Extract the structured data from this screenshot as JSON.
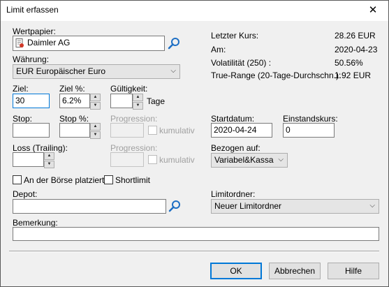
{
  "window": {
    "title": "Limit erfassen",
    "close_glyph": "✕"
  },
  "wertpapier": {
    "label": "Wertpapier:",
    "value": "Daimler AG"
  },
  "waehrung": {
    "label": "Währung:",
    "value": "EUR Europäischer Euro"
  },
  "info": {
    "rows": [
      {
        "label": "Letzter Kurs:",
        "value": "28.26 EUR"
      },
      {
        "label": "Am:",
        "value": "2020-04-23"
      },
      {
        "label": "Volatilität (250) :",
        "value": "50.56%"
      },
      {
        "label": "True-Range (20-Tage-Durchschn.):",
        "value": "1.92 EUR"
      }
    ]
  },
  "ziel": {
    "label": "Ziel:",
    "value": "30"
  },
  "ziel_pct": {
    "label": "Ziel %:",
    "value": "6.2%"
  },
  "gueltigkeit": {
    "label": "Gültigkeit:",
    "value": "",
    "unit": "Tage"
  },
  "stop": {
    "label": "Stop:",
    "value": ""
  },
  "stop_pct": {
    "label": "Stop %:",
    "value": ""
  },
  "progression1": {
    "label": "Progression:",
    "value": "",
    "checkbox_label": "kumulativ"
  },
  "startdatum": {
    "label": "Startdatum:",
    "value": "2020-04-24"
  },
  "einstandskurs": {
    "label": "Einstandskurs:",
    "value": "0"
  },
  "loss": {
    "label": "Loss (Trailing):",
    "value": ""
  },
  "progression2": {
    "label": "Progression:",
    "value": "",
    "checkbox_label": "kumulativ"
  },
  "bezogen": {
    "label": "Bezogen auf:",
    "value": "Variabel&Kassa"
  },
  "boerse_checkbox": {
    "label": "An der Börse platziert"
  },
  "shortlimit_checkbox": {
    "label": "Shortlimit"
  },
  "depot": {
    "label": "Depot:",
    "value": ""
  },
  "limitordner": {
    "label": "Limitordner:",
    "value": "Neuer Limitordner"
  },
  "bemerkung": {
    "label": "Bemerkung:",
    "value": ""
  },
  "buttons": {
    "ok": "OK",
    "abbrechen": "Abbrechen",
    "hilfe": "Hilfe"
  },
  "colors": {
    "accent": "#0078d7",
    "window_bg": "#f0f0f0",
    "search_icon": "#1e6fc4"
  }
}
